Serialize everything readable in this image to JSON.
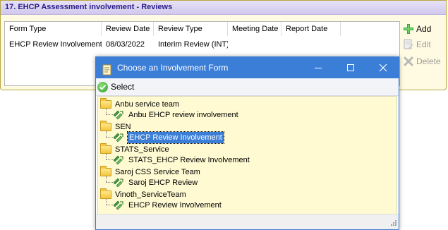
{
  "panel": {
    "title": "17. EHCP Assessment involvement - Reviews",
    "columns": [
      "Form Type",
      "Review Date",
      "Review Type",
      "Meeting Date",
      "Report Date"
    ],
    "rows": [
      [
        "EHCP Review Involvement",
        "08/03/2022",
        "Interim Review (INT)",
        "",
        ""
      ]
    ],
    "actions": {
      "add": "Add",
      "edit": "Edit",
      "delete": "Delete"
    }
  },
  "dialog": {
    "title": "Choose an Involvement Form",
    "toolbar": {
      "select": "Select"
    },
    "tree": [
      {
        "group": "Anbu service team",
        "items": [
          "Anbu EHCP review involvement"
        ]
      },
      {
        "group": "SEN",
        "items": [
          "EHCP Review Involvement"
        ]
      },
      {
        "group": "STATS_Service",
        "items": [
          "STATS_EHCP Review Involvement"
        ]
      },
      {
        "group": "Saroj CSS Service Team",
        "items": [
          "Saroj EHCP Review"
        ]
      },
      {
        "group": "Vinoth_ServiceTeam",
        "items": [
          "EHCP Review Involvement"
        ]
      }
    ],
    "selected_item": "EHCP Review Involvement",
    "selected_group": "SEN"
  },
  "colors": {
    "panel_bg": "#fffbe2",
    "header_text": "#2a1b88",
    "titlebar": "#3b7ed8",
    "tree_bg": "#fffad2",
    "selection": "#3b7ed8"
  }
}
